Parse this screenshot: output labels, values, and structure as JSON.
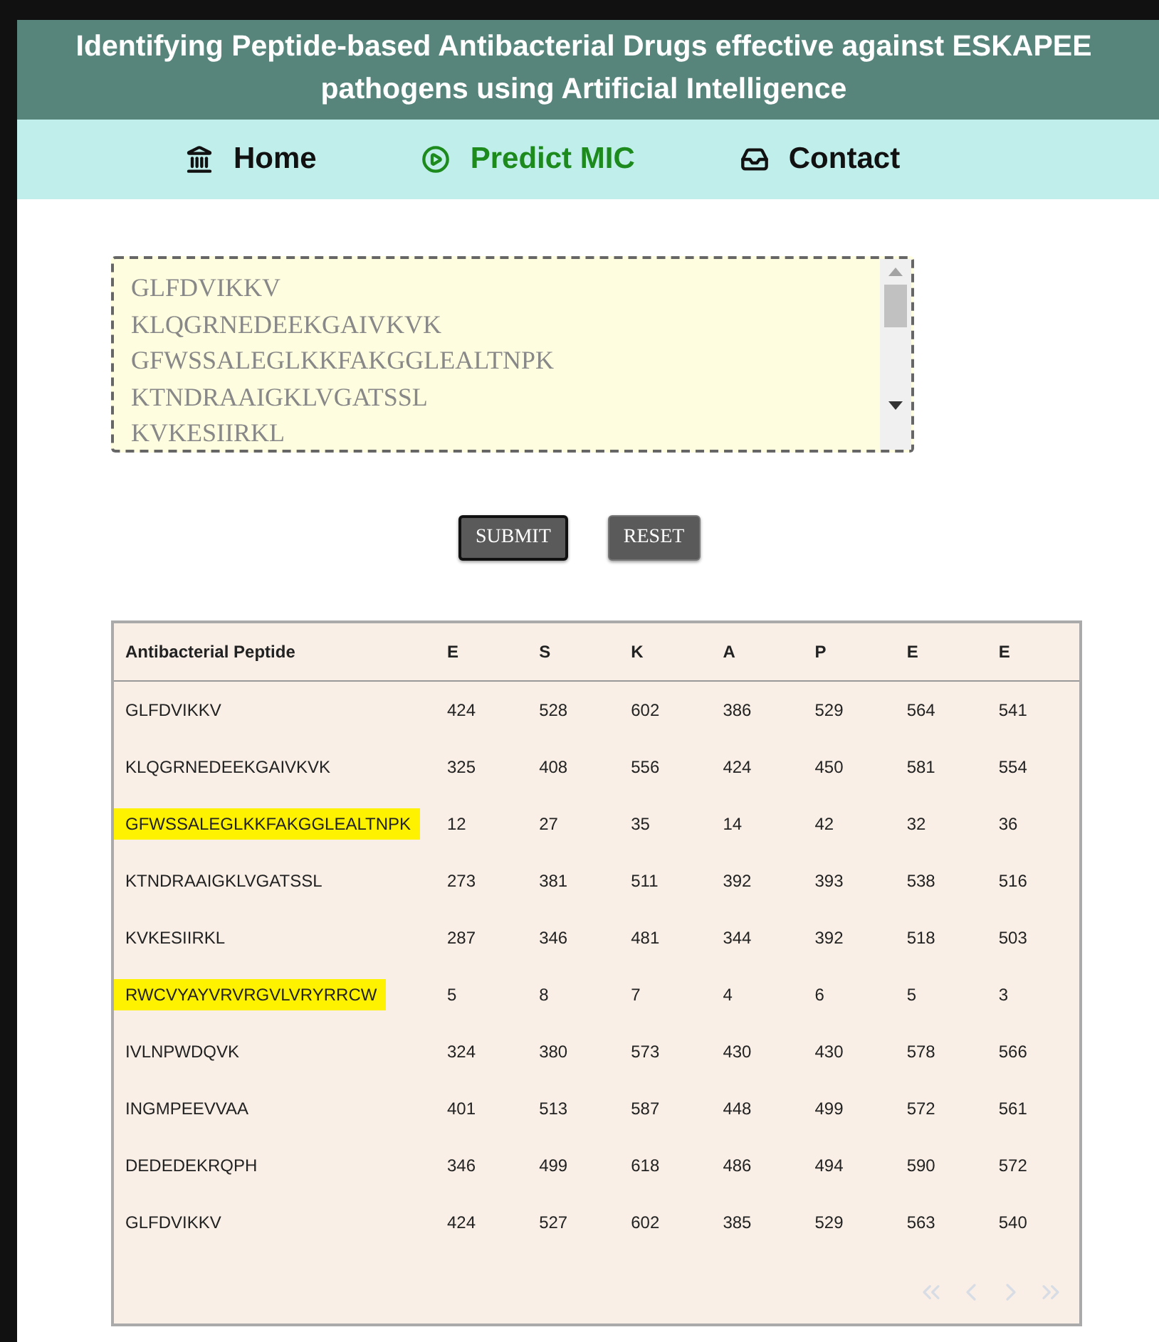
{
  "header": {
    "title": "Identifying Peptide-based Antibacterial Drugs effective against ESKAPEE pathogens using Artificial Intelligence"
  },
  "nav": [
    {
      "label": "Home",
      "selected": false
    },
    {
      "label": "Predict MIC",
      "selected": true
    },
    {
      "label": "Contact",
      "selected": false
    }
  ],
  "input": {
    "lines": [
      "GLFDVIKKV",
      "KLQGRNEDEEKGAIVKVK",
      "GFWSSALEGLKKFAKGGLEALTNPK",
      "KTNDRAAIGKLVGATSSL",
      "KVKESIIRKL"
    ]
  },
  "buttons": [
    {
      "label": "SUBMIT",
      "focused": true
    },
    {
      "label": "RESET",
      "focused": false
    }
  ],
  "table": {
    "columns": [
      "Antibacterial Peptide",
      "E",
      "S",
      "K",
      "A",
      "P",
      "E",
      "E"
    ],
    "rows": [
      {
        "peptide": "GLFDVIKKV",
        "highlighted": false,
        "values": [
          "424",
          "528",
          "602",
          "386",
          "529",
          "564",
          "541"
        ]
      },
      {
        "peptide": "KLQGRNEDEEKGAIVKVK",
        "highlighted": false,
        "values": [
          "325",
          "408",
          "556",
          "424",
          "450",
          "581",
          "554"
        ]
      },
      {
        "peptide": "GFWSSALEGLKKFAKGGLEALTNPK",
        "highlighted": true,
        "values": [
          "12",
          "27",
          "35",
          "14",
          "42",
          "32",
          "36"
        ]
      },
      {
        "peptide": "KTNDRAAIGKLVGATSSL",
        "highlighted": false,
        "values": [
          "273",
          "381",
          "511",
          "392",
          "393",
          "538",
          "516"
        ]
      },
      {
        "peptide": "KVKESIIRKL",
        "highlighted": false,
        "values": [
          "287",
          "346",
          "481",
          "344",
          "392",
          "518",
          "503"
        ]
      },
      {
        "peptide": "RWCVYAYVRVRGVLVRYRRCW",
        "highlighted": true,
        "values": [
          "5",
          "8",
          "7",
          "4",
          "6",
          "5",
          "3"
        ]
      },
      {
        "peptide": "IVLNPWDQVK",
        "highlighted": false,
        "values": [
          "324",
          "380",
          "573",
          "430",
          "430",
          "578",
          "566"
        ]
      },
      {
        "peptide": "INGMPEEVVAA",
        "highlighted": false,
        "values": [
          "401",
          "513",
          "587",
          "448",
          "499",
          "572",
          "561"
        ]
      },
      {
        "peptide": "DEDEDEKRQPH",
        "highlighted": false,
        "values": [
          "346",
          "499",
          "618",
          "486",
          "494",
          "590",
          "572"
        ]
      },
      {
        "peptide": "GLFDVIKKV",
        "highlighted": false,
        "values": [
          "424",
          "527",
          "602",
          "385",
          "529",
          "563",
          "540"
        ]
      }
    ]
  },
  "pagination": {
    "disabled": true
  }
}
